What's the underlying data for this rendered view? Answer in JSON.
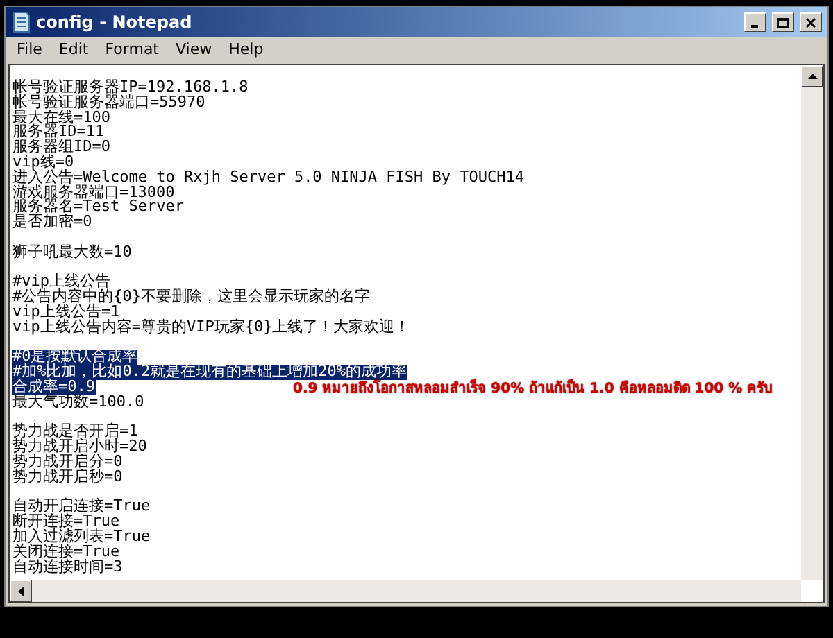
{
  "window": {
    "title": "config - Notepad"
  },
  "menu": [
    "File",
    "Edit",
    "Format",
    "View",
    "Help"
  ],
  "lines": [
    {
      "kind": "text",
      "text": "帐号验证服务器IP=192.168.1.8",
      "selected": false
    },
    {
      "kind": "text",
      "text": "帐号验证服务器端口=55970",
      "selected": false
    },
    {
      "kind": "text",
      "text": "最大在线=100",
      "selected": false
    },
    {
      "kind": "text",
      "text": "服务器ID=11",
      "selected": false
    },
    {
      "kind": "text",
      "text": "服务器组ID=0",
      "selected": false
    },
    {
      "kind": "text",
      "text": "vip线=0",
      "selected": false
    },
    {
      "kind": "text",
      "text": "进入公告=Welcome to Rxjh Server 5.0 NINJA FISH By TOUCH14",
      "selected": false
    },
    {
      "kind": "text",
      "text": "游戏服务器端口=13000",
      "selected": false
    },
    {
      "kind": "text",
      "text": "服务器名=Test Server",
      "selected": false
    },
    {
      "kind": "text",
      "text": "是否加密=0",
      "selected": false
    },
    {
      "kind": "blank"
    },
    {
      "kind": "text",
      "text": "狮子吼最大数=10",
      "selected": false
    },
    {
      "kind": "blank"
    },
    {
      "kind": "text",
      "text": "#vip上线公告",
      "selected": false
    },
    {
      "kind": "text",
      "text": "#公告内容中的{0}不要删除，这里会显示玩家的名字",
      "selected": false
    },
    {
      "kind": "text",
      "text": "vip上线公告=1",
      "selected": false
    },
    {
      "kind": "text",
      "text": "vip上线公告内容=尊贵的VIP玩家{0}上线了！大家欢迎！",
      "selected": false
    },
    {
      "kind": "blank"
    },
    {
      "kind": "text",
      "text": "#0是按默认合成率",
      "selected": true
    },
    {
      "kind": "text",
      "text": "#加%比加，比如0.2就是在现有的基础上增加20%的成功率",
      "selected": true
    },
    {
      "kind": "text",
      "text": "合成率=0.9",
      "selected": true
    },
    {
      "kind": "text",
      "text": "最大气功数=100.0",
      "selected": false
    },
    {
      "kind": "blank"
    },
    {
      "kind": "text",
      "text": "势力战是否开启=1",
      "selected": false
    },
    {
      "kind": "text",
      "text": "势力战开启小时=20",
      "selected": false
    },
    {
      "kind": "text",
      "text": "势力战开启分=0",
      "selected": false
    },
    {
      "kind": "text",
      "text": "势力战开启秒=0",
      "selected": false
    },
    {
      "kind": "blank"
    },
    {
      "kind": "text",
      "text": "自动开启连接=True",
      "selected": false
    },
    {
      "kind": "text",
      "text": "断开连接=True",
      "selected": false
    },
    {
      "kind": "text",
      "text": "加入过滤列表=True",
      "selected": false
    },
    {
      "kind": "text",
      "text": "关闭连接=True",
      "selected": false
    },
    {
      "kind": "text",
      "text": "自动连接时间=3",
      "selected": false
    }
  ],
  "annotation": "0.9 หมายถึงโอกาสหลอมสำเร็จ 90% ถ้าแก้เป็น 1.0 คือหลอมติด 100 % ครับ"
}
